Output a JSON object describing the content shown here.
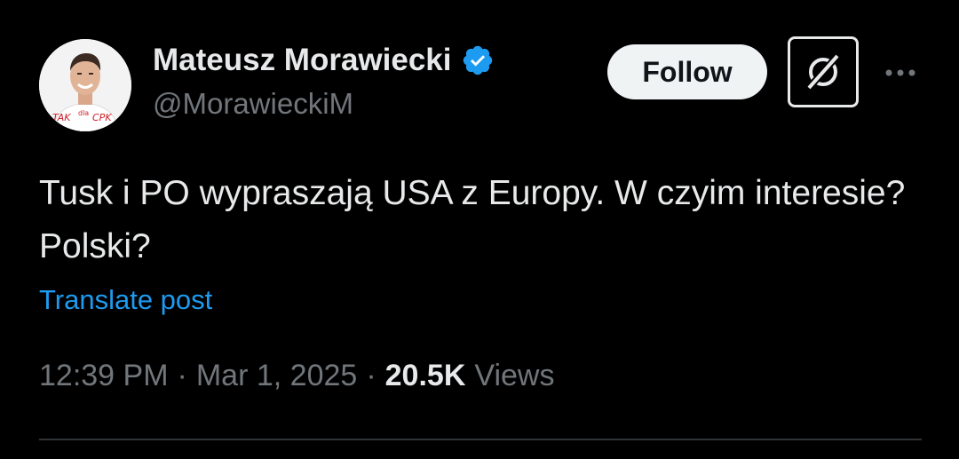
{
  "author": {
    "display_name": "Mateusz Morawiecki",
    "handle": "@MorawieckiM",
    "verified": true,
    "avatar_shirt_text": "TAK dla CPK"
  },
  "actions": {
    "follow_label": "Follow",
    "grok_icon": "grok-icon",
    "more_icon": "more-horizontal-icon"
  },
  "post": {
    "text": "Tusk i PO wypraszają USA z Europy. W czyim interesie? Polski?",
    "translate_label": "Translate post"
  },
  "meta": {
    "time": "12:39 PM",
    "separator": "·",
    "date": "Mar 1, 2025",
    "views_count": "20.5K",
    "views_label": "Views"
  },
  "colors": {
    "background": "#000000",
    "primary_text": "#e7e9ea",
    "secondary_text": "#71767b",
    "link": "#1d9bf0",
    "verified_badge": "#1d9bf0",
    "follow_button_bg": "#eff3f4"
  }
}
